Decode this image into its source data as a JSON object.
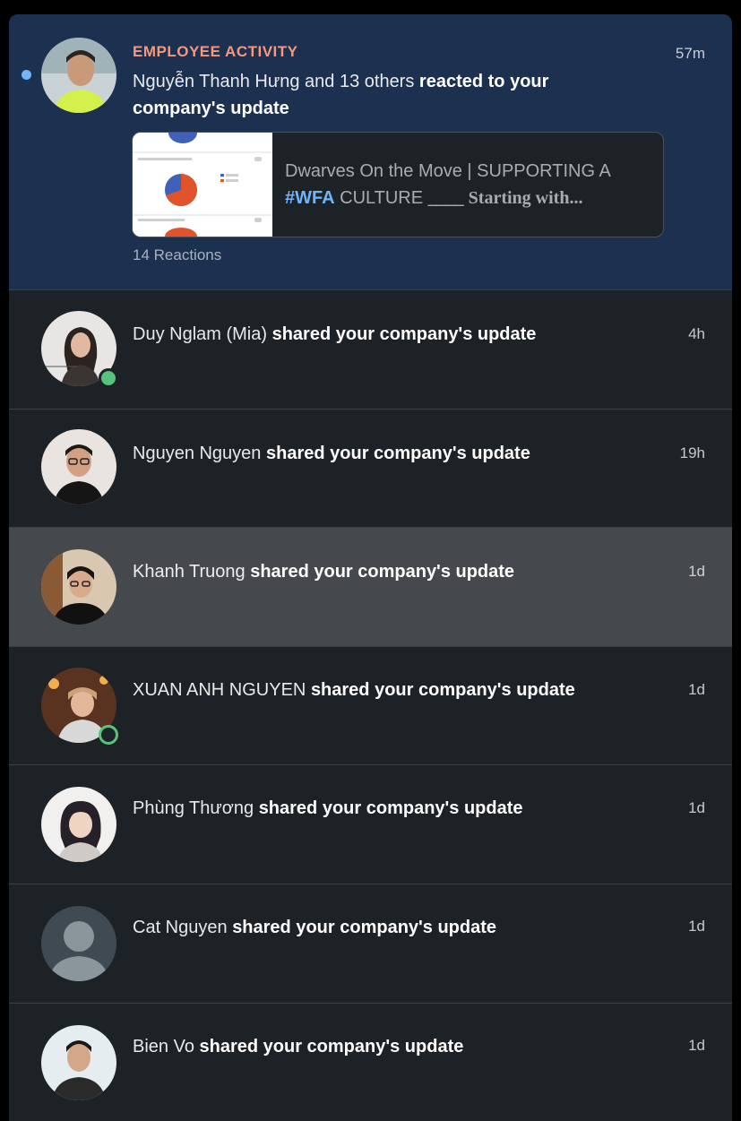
{
  "featured": {
    "kicker": "EMPLOYEE ACTIVITY",
    "actor": "Nguyễn Thanh Hưng and 13 others",
    "action_line1": "reacted to your",
    "action_line2": "company's update",
    "time": "57m",
    "card": {
      "title": "Dwarves On the Move | SUPPORTING A",
      "hashtag": "#WFA",
      "tail_text": "CULTURE",
      "tail_serif": "____ Starting with..."
    },
    "reactions": "14 Reactions",
    "avatar_icon": "person-photo"
  },
  "action_text": "shared your company's update",
  "items": [
    {
      "name": "Duy Nglam (Mia)",
      "time": "4h",
      "presence": "active"
    },
    {
      "name": "Nguyen Nguyen",
      "time": "19h",
      "presence": "none"
    },
    {
      "name": "Khanh Truong",
      "time": "1d",
      "presence": "none"
    },
    {
      "name": "XUAN ANH NGUYEN",
      "time": "1d",
      "presence": "away"
    },
    {
      "name": "Phùng Thương",
      "time": "1d",
      "presence": "none"
    },
    {
      "name": "Cat Nguyen",
      "time": "1d",
      "presence": "none"
    },
    {
      "name": "Bien Vo",
      "time": "1d",
      "presence": "none"
    }
  ],
  "colors": {
    "background": "#1d2226",
    "unread_background": "#1c3050",
    "hover_background": "#45484c",
    "kicker": "#f5987e",
    "hashtag": "#70b5f9",
    "presence": "#57c27a"
  }
}
